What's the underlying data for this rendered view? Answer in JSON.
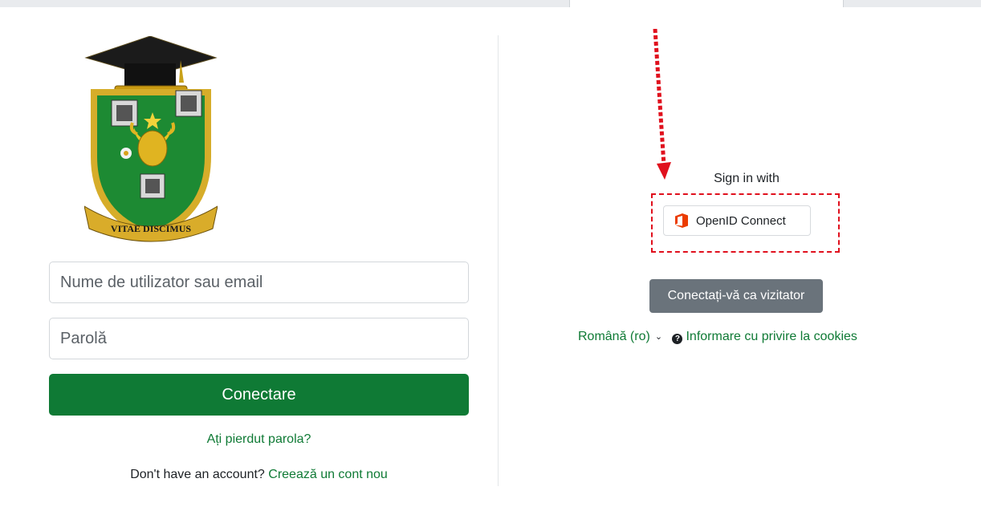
{
  "login": {
    "username_placeholder": "Nume de utilizator sau email",
    "password_placeholder": "Parolă",
    "submit_label": "Conectare",
    "forgot_link": "Ați pierdut parola?",
    "no_account_text": "Don't have an account?",
    "create_account_link": "Creează un cont nou"
  },
  "logo": {
    "motto": "VITAE DISCIMUS"
  },
  "sso": {
    "sign_in_with": "Sign in with",
    "provider_label": "OpenID Connect"
  },
  "guest": {
    "button_label": "Conectați-vă ca vizitator"
  },
  "footer": {
    "language": "Română (ro)",
    "cookies_link": "Informare cu privire la cookies"
  },
  "colors": {
    "primary": "#0f7a35",
    "secondary_button": "#6a737b",
    "annotation": "#e0101d",
    "office_icon": "#eb3c00"
  },
  "icons": [
    "emblem-logo",
    "office-icon",
    "chevron-down-icon",
    "question-circle-icon",
    "annotation-arrow"
  ]
}
